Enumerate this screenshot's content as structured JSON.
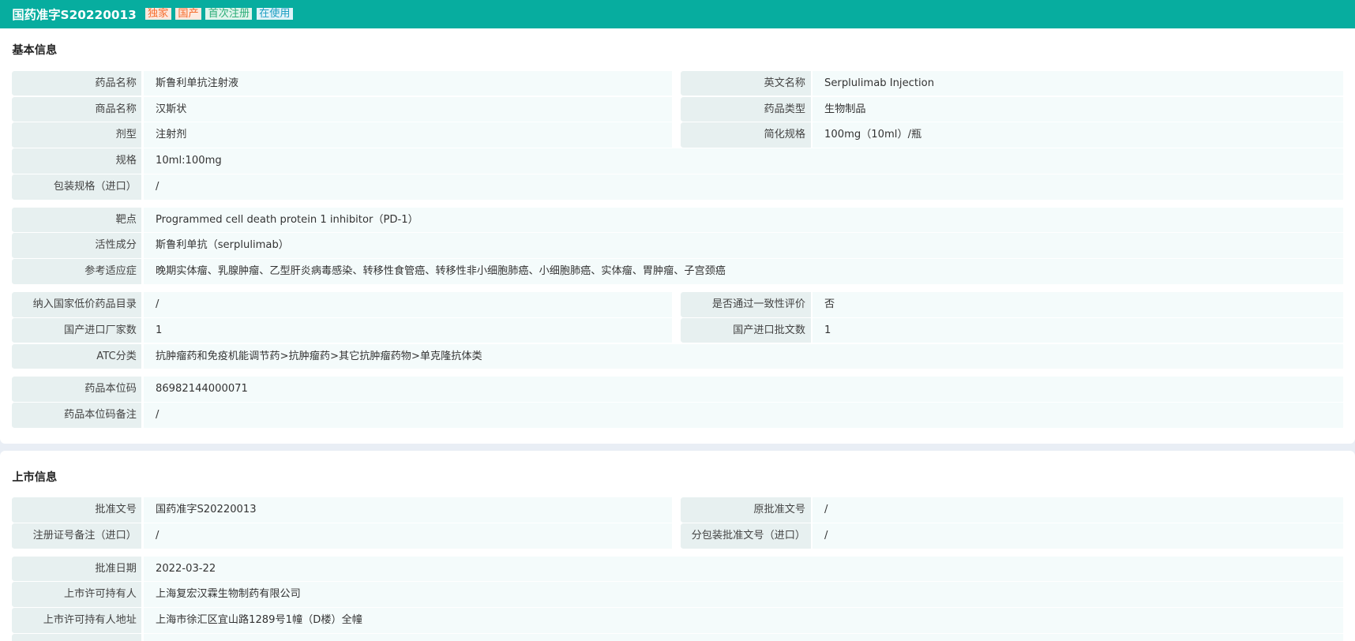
{
  "header": {
    "title": "国药准字S20220013",
    "tags": [
      {
        "text": "独家",
        "color": "#f56c2c",
        "bg": "#fde9df"
      },
      {
        "text": "国产",
        "color": "#f56c2c",
        "bg": "#fde9df"
      },
      {
        "text": "首次注册",
        "color": "#2fae7a",
        "bg": "#dff5ec"
      },
      {
        "text": "在使用",
        "color": "#1f9fc2",
        "bg": "#dff2f8"
      }
    ]
  },
  "basic": {
    "title": "基本信息",
    "g1": [
      {
        "l": "药品名称",
        "v": "斯鲁利单抗注射液",
        "l2": "英文名称",
        "v2": "Serplulimab Injection"
      },
      {
        "l": "商品名称",
        "v": "汉斯状",
        "l2": "药品类型",
        "v2": "生物制品"
      },
      {
        "l": "剂型",
        "v": "注射剂",
        "l2": "简化规格",
        "v2": "100mg（10ml）/瓶"
      },
      {
        "l": "规格",
        "v": "10ml:100mg"
      },
      {
        "l": "包装规格（进口）",
        "v": "/"
      }
    ],
    "g2": [
      {
        "l": "靶点",
        "v": "Programmed cell death protein 1 inhibitor（PD-1）"
      },
      {
        "l": "活性成分",
        "v": "斯鲁利单抗（serplulimab）"
      },
      {
        "l": "参考适应症",
        "v": "晚期实体瘤、乳腺肿瘤、乙型肝炎病毒感染、转移性食管癌、转移性非小细胞肺癌、小细胞肺癌、实体瘤、胃肿瘤、子宫颈癌"
      }
    ],
    "g3": [
      {
        "l": "纳入国家低价药品目录",
        "v": "/",
        "l2": "是否通过一致性评价",
        "v2": "否"
      },
      {
        "l": "国产进口厂家数",
        "v": "1",
        "l2": "国产进口批文数",
        "v2": "1"
      },
      {
        "l": "ATC分类",
        "v": "抗肿瘤药和免疫机能调节药>抗肿瘤药>其它抗肿瘤药物>单克隆抗体类"
      }
    ],
    "g4": [
      {
        "l": "药品本位码",
        "v": "86982144000071"
      },
      {
        "l": "药品本位码备注",
        "v": "/"
      }
    ]
  },
  "market": {
    "title": "上市信息",
    "g1": [
      {
        "l": "批准文号",
        "v": "国药准字S20220013",
        "l2": "原批准文号",
        "v2": "/"
      },
      {
        "l": "注册证号备注（进口）",
        "v": "/",
        "l2": "分包装批准文号（进口）",
        "v2": "/"
      }
    ],
    "g2": [
      {
        "l": "批准日期",
        "v": "2022-03-22"
      },
      {
        "l": "上市许可持有人",
        "v": "上海复宏汉霖生物制药有限公司"
      },
      {
        "l": "上市许可持有人地址",
        "v": "上海市徐汇区宜山路1289号1幢（D楼）全幢"
      },
      {
        "l": "",
        "v": ""
      }
    ]
  }
}
